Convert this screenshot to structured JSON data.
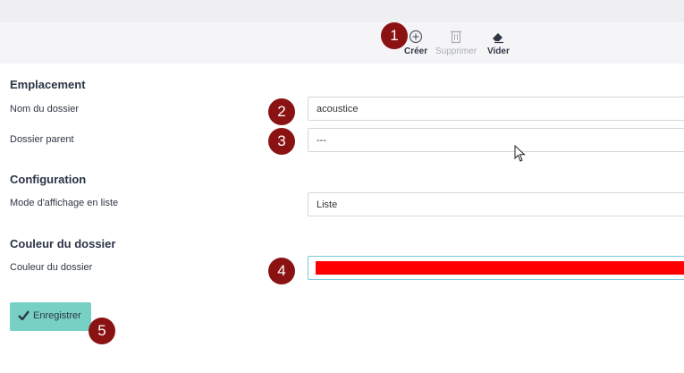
{
  "toolbar": {
    "create_label": "Créer",
    "delete_label": "Supprimer",
    "clear_label": "Vider"
  },
  "form": {
    "location_heading": "Emplacement",
    "folder_name_label": "Nom du dossier",
    "folder_name_value": "acoustice",
    "parent_folder_label": "Dossier parent",
    "parent_folder_value": "---",
    "configuration_heading": "Configuration",
    "list_display_label": "Mode d'affichage en liste",
    "list_display_value": "Liste",
    "color_heading": "Couleur du dossier",
    "color_label": "Couleur du dossier",
    "color_value": "#ff0000"
  },
  "save_label": "Enregistrer",
  "badges": [
    "1",
    "2",
    "3",
    "4",
    "5"
  ],
  "colors": {
    "badge": "#8b1212",
    "save_button": "#76d1c4",
    "color_field_border": "#7cc9da"
  },
  "icons": {
    "create": "plus-circle-icon",
    "delete": "trash-icon",
    "clear": "eraser-icon",
    "save": "checkmark-icon",
    "cursor": "mouse-pointer-icon"
  }
}
